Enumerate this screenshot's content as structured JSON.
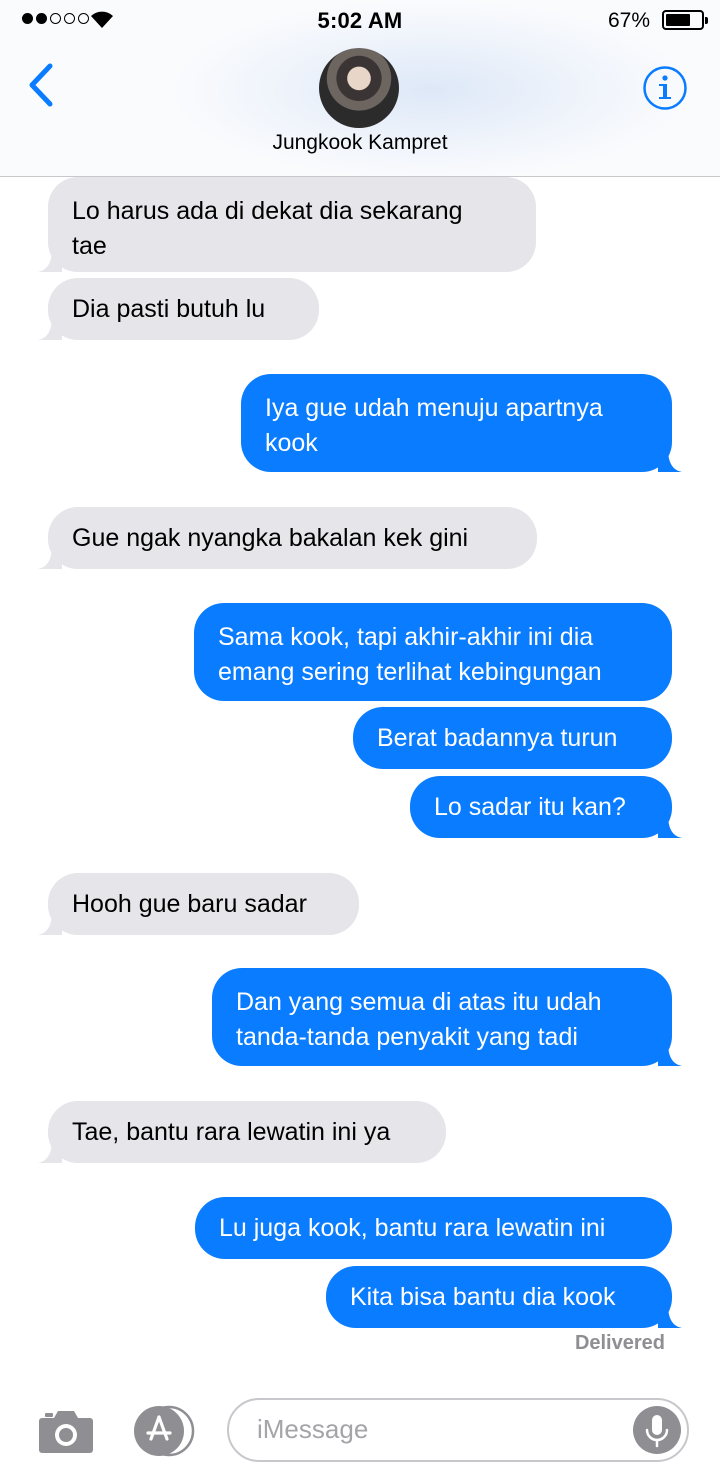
{
  "status": {
    "time": "5:02 AM",
    "battery": "67%"
  },
  "header": {
    "contact": "Jungkook Kampret"
  },
  "messages": [
    {
      "from": "them",
      "text": "Lo harus ada di dekat dia sekarang\ntae"
    },
    {
      "from": "them",
      "text": "Dia pasti butuh lu"
    },
    {
      "from": "me",
      "text": "Iya gue udah menuju apartnya\nkook"
    },
    {
      "from": "them",
      "text": "Gue ngak nyangka bakalan kek gini"
    },
    {
      "from": "me",
      "text": "Sama kook, tapi akhir-akhir ini dia\nemang sering terlihat kebingungan"
    },
    {
      "from": "me",
      "text": "Berat badannya turun"
    },
    {
      "from": "me",
      "text": "Lo sadar itu kan?"
    },
    {
      "from": "them",
      "text": "Hooh gue baru sadar"
    },
    {
      "from": "me",
      "text": "Dan yang semua di atas itu udah\ntanda-tanda penyakit yang tadi"
    },
    {
      "from": "them",
      "text": "Tae, bantu rara lewatin ini ya"
    },
    {
      "from": "me",
      "text": "Lu juga kook, bantu rara lewatin ini"
    },
    {
      "from": "me",
      "text": "Kita bisa bantu dia kook"
    }
  ],
  "delivered": "Delivered",
  "input": {
    "placeholder": "iMessage"
  },
  "colors": {
    "sent": "#0a7cff",
    "received": "#e5e5ea",
    "accent": "#0a7cff"
  },
  "icons": [
    "back-chevron-icon",
    "info-icon",
    "camera-icon",
    "app-store-icon",
    "microphone-icon",
    "wifi-icon"
  ]
}
